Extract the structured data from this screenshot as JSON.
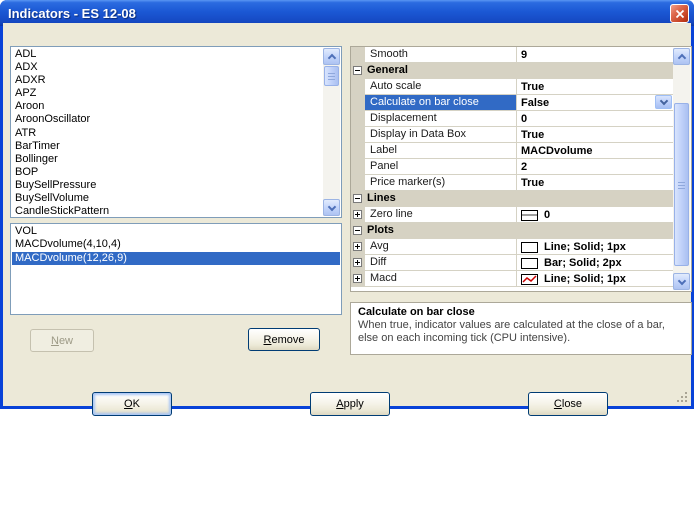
{
  "window": {
    "title": "Indicators - ES 12-08"
  },
  "available_indicators": {
    "items": [
      "ADL",
      "ADX",
      "ADXR",
      "APZ",
      "Aroon",
      "AroonOscillator",
      "ATR",
      "BarTimer",
      "Bollinger",
      "BOP",
      "BuySellPressure",
      "BuySellVolume",
      "CandleStickPattern"
    ]
  },
  "configured_indicators": {
    "items": [
      "VOL",
      "MACDvolume(4,10,4)",
      "MACDvolume(12,26,9)"
    ],
    "selected": "MACDvolume(12,26,9)",
    "selected_index": 2
  },
  "buttons": {
    "new": "New",
    "remove": "Remove",
    "ok": "OK",
    "apply": "Apply",
    "close": "Close"
  },
  "property_grid": {
    "rows": [
      {
        "type": "item",
        "name": "Smooth",
        "value": "9"
      },
      {
        "type": "category",
        "name": "General"
      },
      {
        "type": "item",
        "name": "Auto scale",
        "value": "True"
      },
      {
        "type": "item",
        "name": "Calculate on bar close",
        "value": "False",
        "selected": true,
        "editor": "dropdown"
      },
      {
        "type": "item",
        "name": "Displacement",
        "value": "0"
      },
      {
        "type": "item",
        "name": "Display in Data Box",
        "value": "True"
      },
      {
        "type": "item",
        "name": "Label",
        "value": "MACDvolume"
      },
      {
        "type": "item",
        "name": "Panel",
        "value": "2"
      },
      {
        "type": "item",
        "name": "Price marker(s)",
        "value": "True"
      },
      {
        "type": "category",
        "name": "Lines"
      },
      {
        "type": "item",
        "name": "Zero line",
        "value": "0",
        "expandable": true,
        "icon": "zero-line-swatch"
      },
      {
        "type": "category",
        "name": "Plots"
      },
      {
        "type": "item",
        "name": "Avg",
        "value": "Line; Solid; 1px",
        "expandable": true,
        "icon": "empty-swatch"
      },
      {
        "type": "item",
        "name": "Diff",
        "value": "Bar; Solid; 2px",
        "expandable": true,
        "icon": "empty-swatch"
      },
      {
        "type": "item",
        "name": "Macd",
        "value": "Line; Solid; 1px",
        "expandable": true,
        "icon": "macd-line-swatch"
      }
    ]
  },
  "help_panel": {
    "title": "Calculate on bar close",
    "description": "When true, indicator values are calculated at the close of a bar, else on each incoming tick (CPU intensive)."
  },
  "colors": {
    "dialog_background": "#ECE9D8",
    "window_border": "#0842D8",
    "titlebar_gradient_top": "#5A96F2",
    "titlebar_gradient_bottom": "#0B37A6",
    "selection_highlight": "#316AC5",
    "category_row_background": "#D6D2C3",
    "macd_plot_line": "#CC0000"
  }
}
